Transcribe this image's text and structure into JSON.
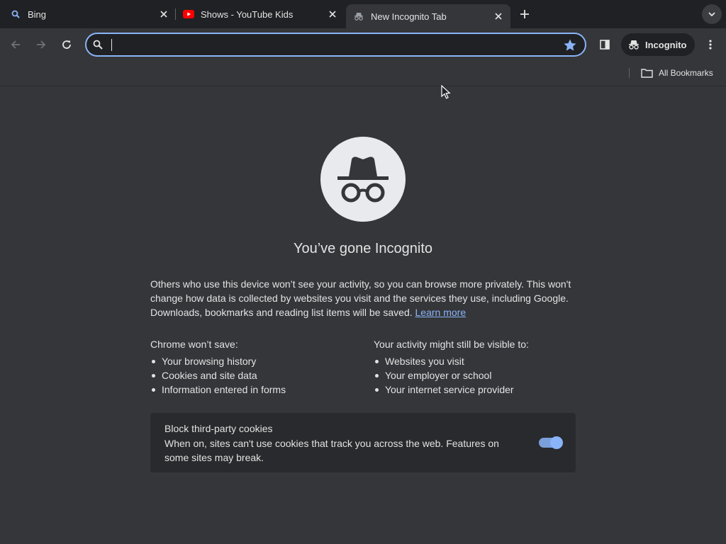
{
  "tabs": [
    {
      "title": "Bing",
      "icon": "bing-search-icon",
      "active": false
    },
    {
      "title": "Shows - YouTube Kids",
      "icon": "youtube-icon",
      "active": false
    },
    {
      "title": "New Incognito Tab",
      "icon": "incognito-icon",
      "active": true
    }
  ],
  "toolbar": {
    "omnibox_value": "",
    "incognito_label": "Incognito"
  },
  "bookmarks": {
    "all_bookmarks_label": "All Bookmarks"
  },
  "content": {
    "heading": "You’ve gone Incognito",
    "description": "Others who use this device won’t see your activity, so you can browse more privately. This won't change how data is collected by websites you visit and the services they use, including Google. Downloads, bookmarks and reading list items will be saved.",
    "learn_more": "Learn more",
    "wont_save_title": "Chrome won’t save:",
    "wont_save_items": [
      "Your browsing history",
      "Cookies and site data",
      "Information entered in forms"
    ],
    "visible_title": "Your activity might still be visible to:",
    "visible_items": [
      "Websites you visit",
      "Your employer or school",
      "Your internet service provider"
    ],
    "cookie_title": "Block third-party cookies",
    "cookie_desc": "When on, sites can't use cookies that track you across the web. Features on some sites may break.",
    "cookie_toggle_on": true
  },
  "colors": {
    "accent": "#8ab4f8",
    "background": "#35363a",
    "tabstrip": "#202124",
    "card": "#292a2d",
    "youtube_red": "#ff0000",
    "bing_blue": "#8ab4f8"
  }
}
